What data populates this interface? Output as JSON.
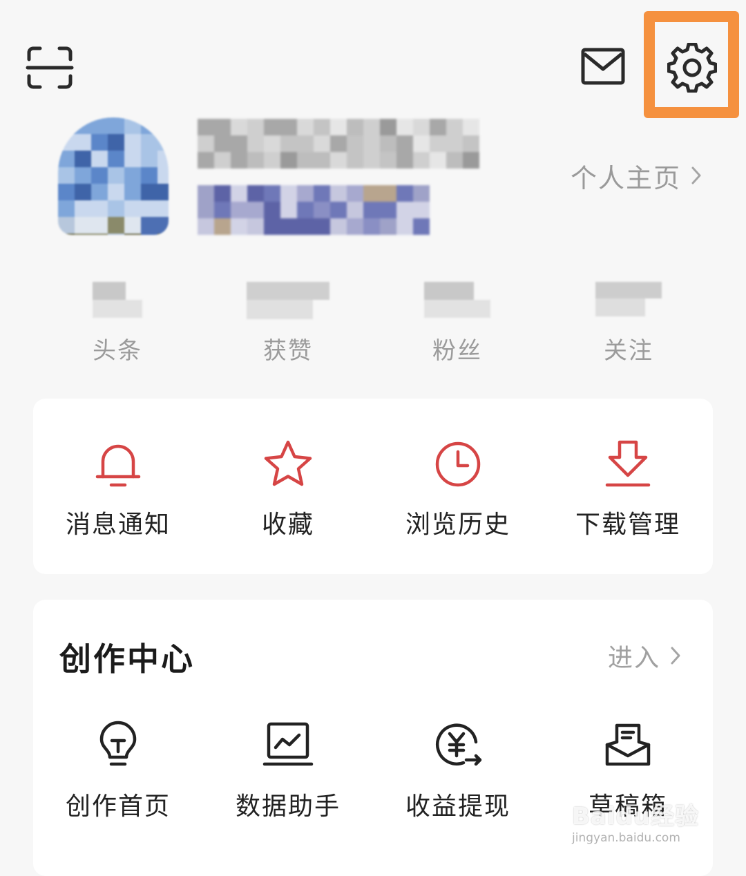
{
  "profile": {
    "homepage_link": "个人主页"
  },
  "stats": [
    {
      "label": "头条"
    },
    {
      "label": "获赞"
    },
    {
      "label": "粉丝"
    },
    {
      "label": "关注"
    }
  ],
  "tools": [
    {
      "label": "消息通知",
      "icon": "bell-icon"
    },
    {
      "label": "收藏",
      "icon": "star-icon"
    },
    {
      "label": "浏览历史",
      "icon": "clock-icon"
    },
    {
      "label": "下载管理",
      "icon": "download-icon"
    }
  ],
  "creator": {
    "title": "创作中心",
    "enter": "进入",
    "items": [
      {
        "label": "创作首页",
        "icon": "lightbulb-icon"
      },
      {
        "label": "数据助手",
        "icon": "chart-monitor-icon"
      },
      {
        "label": "收益提现",
        "icon": "yen-coin-icon"
      },
      {
        "label": "草稿箱",
        "icon": "draft-box-icon"
      }
    ]
  },
  "watermark": {
    "logo": "Baidu经验",
    "url": "jingyan.baidu.com"
  },
  "colors": {
    "accent_red": "#d64545",
    "highlight_orange": "#f5913f",
    "background": "#f7f7f7"
  }
}
